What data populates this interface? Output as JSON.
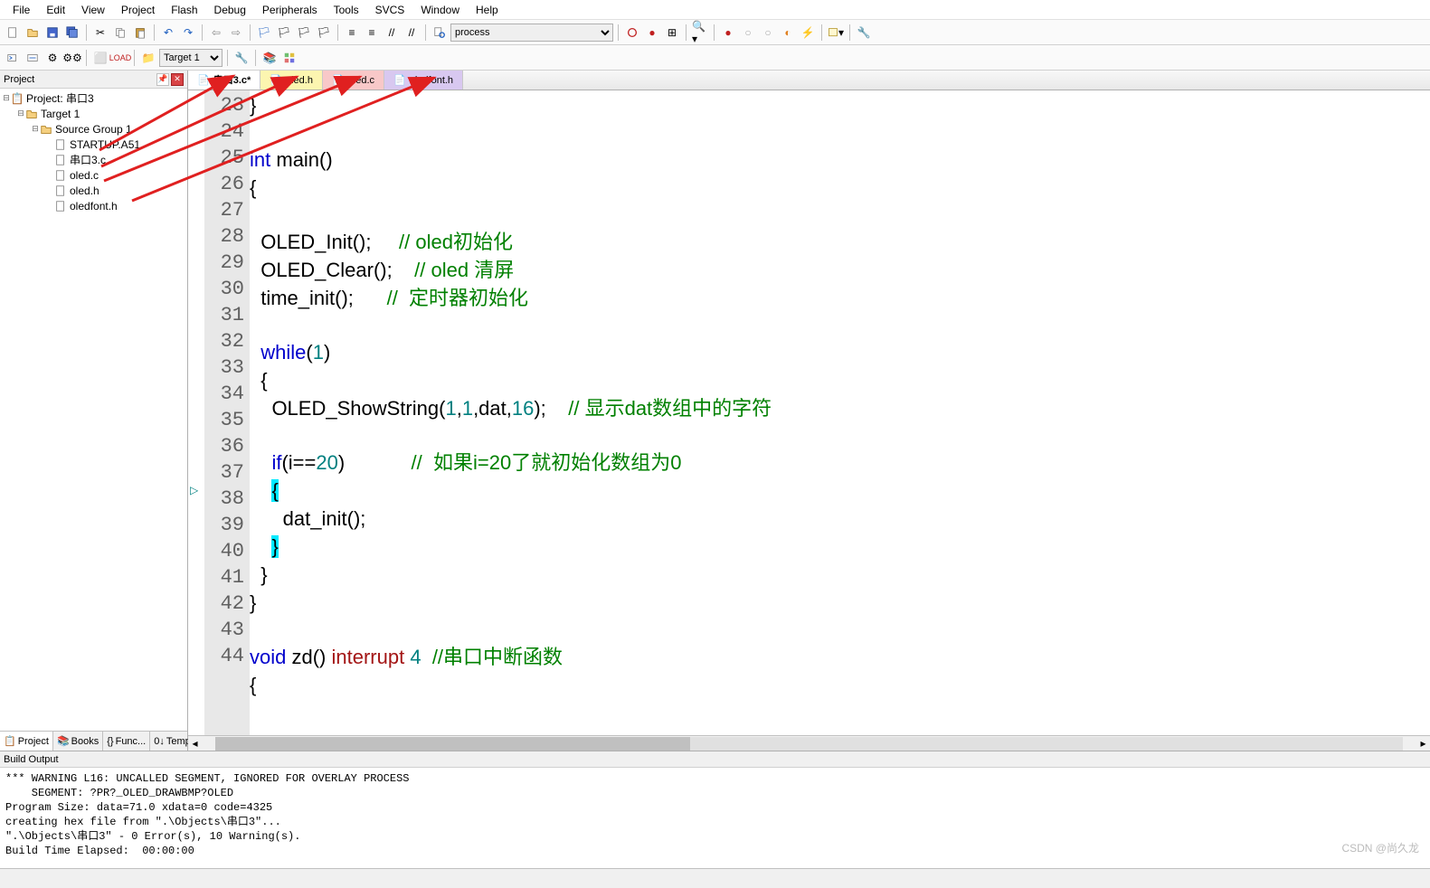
{
  "menu": [
    "File",
    "Edit",
    "View",
    "Project",
    "Flash",
    "Debug",
    "Peripherals",
    "Tools",
    "SVCS",
    "Window",
    "Help"
  ],
  "toolbar2": {
    "target_combo": "Target 1",
    "search_combo": "process"
  },
  "sidebar": {
    "title": "Project",
    "tree": {
      "root": "Project: 串口3",
      "target": "Target 1",
      "group": "Source Group 1",
      "files": [
        "STARTUP.A51",
        "串口3.c",
        "oled.c",
        "oled.h",
        "oledfont.h"
      ]
    },
    "tabs": [
      "Project",
      "Books",
      "Func...",
      "Temp..."
    ]
  },
  "tabs": [
    {
      "name": "串口3.c*",
      "cls": "active"
    },
    {
      "name": "oled.h",
      "cls": "h-yellow"
    },
    {
      "name": "oled.c",
      "cls": "h-pink"
    },
    {
      "name": "oledfont.h",
      "cls": "h-purple"
    }
  ],
  "lines": {
    "start": 23,
    "end": 44
  },
  "code": {
    "l23": "}",
    "l25a": "int",
    "l25b": " main()",
    "l26": "{",
    "l28a": "  OLED_Init();     ",
    "l28c": "// oled初始化",
    "l29a": "  OLED_Clear();    ",
    "l29c": "// oled 清屏",
    "l30a": "  time_init();      ",
    "l30c": "//  定时器初始化",
    "l32a": "  ",
    "l32b": "while",
    "l32c": "(",
    "l32d": "1",
    "l32e": ")",
    "l33": "  {",
    "l34a": "    OLED_ShowString(",
    "l34b": "1",
    "l34c": ",",
    "l34d": "1",
    "l34e": ",dat,",
    "l34f": "16",
    "l34g": ");    ",
    "l34h": "// 显示dat数组中的字符",
    "l36a": "    ",
    "l36b": "if",
    "l36c": "(i==",
    "l36d": "20",
    "l36e": ")            ",
    "l36f": "//  如果i=20了就初始化数组为0",
    "l37a": "    ",
    "l37b": "{",
    "l38": "      dat_init();",
    "l39a": "    ",
    "l39b": "}",
    "l40": "  }",
    "l41": "}",
    "l43a": "void",
    "l43b": " zd() ",
    "l43c": "interrupt",
    "l43d": " ",
    "l43e": "4",
    "l43f": "  ",
    "l43g": "//串口中断函数",
    "l44": "{"
  },
  "build": {
    "title": "Build Output",
    "text": "*** WARNING L16: UNCALLED SEGMENT, IGNORED FOR OVERLAY PROCESS\n    SEGMENT: ?PR?_OLED_DRAWBMP?OLED\nProgram Size: data=71.0 xdata=0 code=4325\ncreating hex file from \".\\Objects\\串口3\"...\n\".\\Objects\\串口3\" - 0 Error(s), 10 Warning(s).\nBuild Time Elapsed:  00:00:00"
  },
  "watermark": "CSDN @尚久龙"
}
